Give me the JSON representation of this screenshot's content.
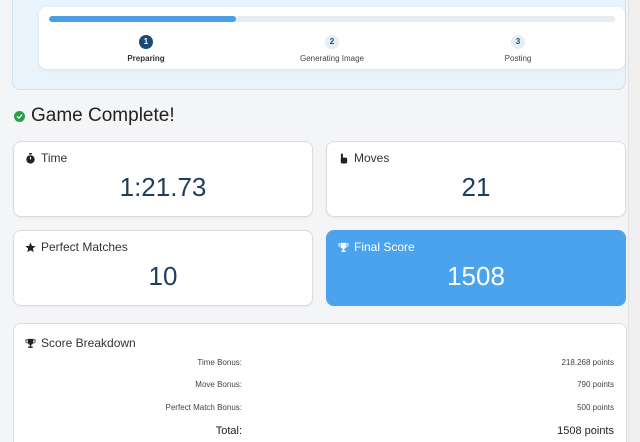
{
  "progress": {
    "fill_fraction": 0.33,
    "steps": [
      {
        "number": "1",
        "label": "Preparing",
        "active": true
      },
      {
        "number": "2",
        "label": "Generating Image",
        "active": false
      },
      {
        "number": "3",
        "label": "Posting",
        "active": false
      }
    ]
  },
  "heading": {
    "icon": "check-circle-icon",
    "title": "Game Complete!"
  },
  "stats": {
    "time": {
      "icon": "stopwatch-icon",
      "label": "Time",
      "value": "1:21.73"
    },
    "moves": {
      "icon": "pointer-hand-icon",
      "label": "Moves",
      "value": "21"
    },
    "perfect": {
      "icon": "star-icon",
      "label": "Perfect Matches",
      "value": "10"
    },
    "final": {
      "icon": "trophy-icon",
      "label": "Final Score",
      "value": "1508"
    }
  },
  "breakdown": {
    "icon": "trophy-icon",
    "title": "Score Breakdown",
    "rows": [
      {
        "label": "Time Bonus:",
        "value": "218.268 points"
      },
      {
        "label": "Move Bonus:",
        "value": "790 points"
      },
      {
        "label": "Perfect Match Bonus:",
        "value": "500 points"
      }
    ],
    "total": {
      "label": "Total:",
      "value": "1508 points"
    }
  },
  "colors": {
    "accent": "#4aa3ec",
    "progress_fill": "#4a9fe4",
    "active_step": "#1b4a72",
    "success": "#2e9d48",
    "value_text": "#1f3d5c"
  }
}
